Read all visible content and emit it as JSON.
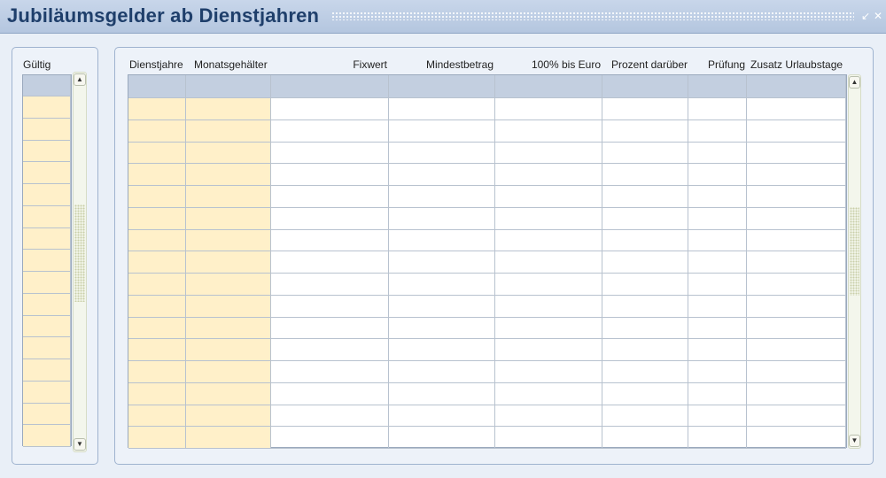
{
  "window": {
    "title": "Jubiläumsgelder ab Dienstjahren",
    "minimize_icon": "minimize-icon",
    "close_icon": "close-icon"
  },
  "left_table": {
    "header": "Gültig",
    "rows": 16
  },
  "right_table": {
    "columns": [
      "Dienstjahre",
      "Monatsgehälter",
      "Fixwert",
      "Mindestbetrag",
      "100% bis Euro",
      "Prozent darüber",
      "Prüfung",
      "Zusatz Urlaubstage"
    ],
    "rows": 16
  },
  "colors": {
    "title": "#1f3f6b",
    "header_row": "#c3cfe0",
    "highlight_column": "#fff0c9",
    "panel_border": "#9fb3cf"
  }
}
